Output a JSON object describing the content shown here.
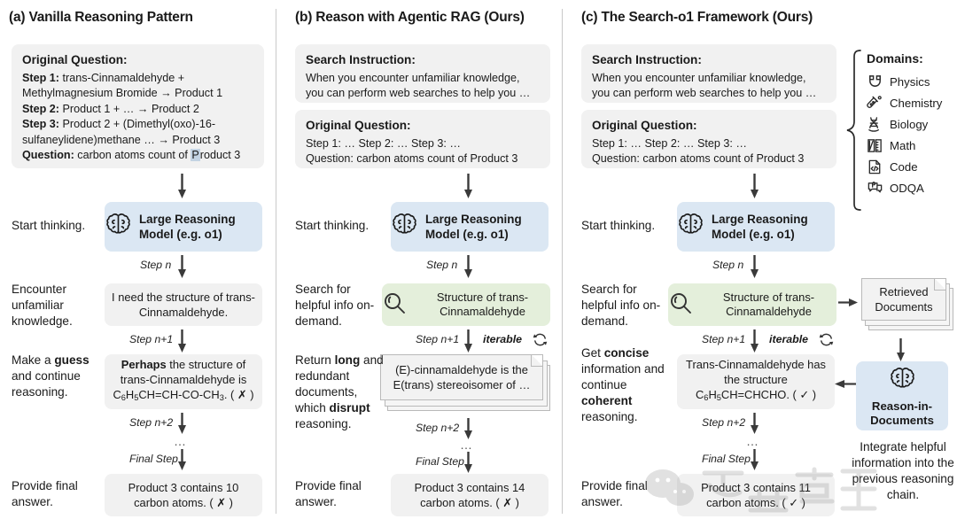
{
  "panels": {
    "a": {
      "title": "(a) Vanilla Reasoning Pattern",
      "question_box": {
        "header": "Original Question:",
        "step1_label": "Step 1:",
        "step1_text": " trans-Cinnamaldehyde + Methylmagnesium Bromide → Product 1",
        "step2_label": "Step 2:",
        "step2_text": " Product 1 + … → Product 2",
        "step3_label": "Step 3:",
        "step3_text": " Product 2 + (Dimethyl(oxo)-16-sulfaneylidene)methane … → Product 3",
        "question_label": "Question:",
        "question_text_pre": " carbon atoms count of ",
        "question_highlight": "P",
        "question_text_post": "roduct 3"
      },
      "notes": {
        "start": "Start thinking.",
        "encounter": "Encounter unfamiliar knowledge.",
        "guess_pre": "Make a ",
        "guess_bold": "guess",
        "guess_post": " and continue reasoning.",
        "final": "Provide final answer."
      },
      "model_box": "Large Reasoning Model (e.g. o1)",
      "thought1": "I need the structure of trans-Cinnamaldehyde.",
      "thought2_bold": "Perhaps",
      "thought2_rest": " the structure of trans-Cinnamaldehyde is",
      "thought2_formula_pre": "C",
      "thought2_formula_sub1": "6",
      "thought2_formula_mid": "H",
      "thought2_formula_sub2": "5",
      "thought2_formula_post": "CH=CH-CO-CH",
      "thought2_formula_sub3": "3",
      "thought2_formula_end": ". ( ✗ )",
      "answer": "Product 3 contains 10 carbon atoms. ( ✗ )",
      "steps": {
        "n": "Step n",
        "n1": "Step n+1",
        "n2": "Step n+2",
        "dots": "…",
        "final": "Final Step"
      }
    },
    "b": {
      "title": "(b) Reason with Agentic RAG (Ours)",
      "instruction_box": {
        "header": "Search Instruction:",
        "line1": "When you encounter unfamiliar knowledge,",
        "line2": "you can perform web searches to help you …"
      },
      "question_box": {
        "header": "Original Question:",
        "line1": "Step 1: … Step 2: … Step 3: …",
        "line2": "Question: carbon atoms count of Product 3"
      },
      "notes": {
        "start": "Start thinking.",
        "search": "Search for helpful info on-demand.",
        "return_pre": "Return ",
        "return_bold1": "long",
        "return_mid": " and redundant documents, which ",
        "return_bold2": "disrupt",
        "return_post": " reasoning.",
        "final": "Provide final answer."
      },
      "model_box": "Large Reasoning Model (e.g. o1)",
      "search_query": "Structure of trans-Cinnamaldehyde",
      "documents": "(E)-cinnamaldehyde is the E(trans) stereoisomer of …",
      "answer": "Product 3 contains 14 carbon atoms. ( ✗ )",
      "iterable": "iterable",
      "steps": {
        "n": "Step n",
        "n1": "Step n+1",
        "n2": "Step n+2",
        "dots": "…",
        "final": "Final Step"
      }
    },
    "c": {
      "title": "(c) The Search-o1 Framework (Ours)",
      "instruction_box": {
        "header": "Search Instruction:",
        "line1": "When you encounter unfamiliar knowledge,",
        "line2": "you can perform web searches to help you …"
      },
      "question_box": {
        "header": "Original Question:",
        "line1": "Step 1: … Step 2: … Step 3: …",
        "line2": "Question: carbon atoms count of Product 3"
      },
      "notes": {
        "start": "Start thinking.",
        "search": "Search for helpful info on-demand.",
        "get_pre": "Get ",
        "get_bold1": "concise",
        "get_mid": " information and continue ",
        "get_bold2": "coherent",
        "get_post": " reasoning.",
        "final": "Provide final answer.",
        "integrate": "Integrate helpful information into the previous reasoning chain."
      },
      "model_box": "Large Reasoning Model (e.g. o1)",
      "search_query": "Structure of trans-Cinnamaldehyde",
      "retrieved_docs": "Retrieved Documents",
      "reason_in_docs": "Reason-in-Documents",
      "refined_line1": "Trans-Cinnamaldehyde",
      "refined_line2": "has the structure",
      "refined_formula_pre": "C",
      "refined_sub1": "6",
      "refined_mid": "H",
      "refined_sub2": "5",
      "refined_post": "CH=CHCHO. ( ✓ )",
      "answer": "Product 3 contains 11 carbon atoms. ( ✓ )",
      "iterable": "iterable",
      "steps": {
        "n": "Step n",
        "n1": "Step n+1",
        "n2": "Step n+2",
        "dots": "…",
        "final": "Final Step"
      },
      "domains": {
        "title": "Domains:",
        "items": [
          {
            "icon": "physics-icon",
            "label": "Physics"
          },
          {
            "icon": "chemistry-icon",
            "label": "Chemistry"
          },
          {
            "icon": "biology-icon",
            "label": "Biology"
          },
          {
            "icon": "math-icon",
            "label": "Math"
          },
          {
            "icon": "code-icon",
            "label": "Code"
          },
          {
            "icon": "odqa-icon",
            "label": "ODQA"
          }
        ]
      }
    }
  },
  "colors": {
    "box_gray": "#f1f1f1",
    "box_blue": "#dbe7f3",
    "box_green": "#e4efdb",
    "divider": "#c9c9c9",
    "highlight": "#c3d3e3",
    "text": "#1a1a1a"
  }
}
